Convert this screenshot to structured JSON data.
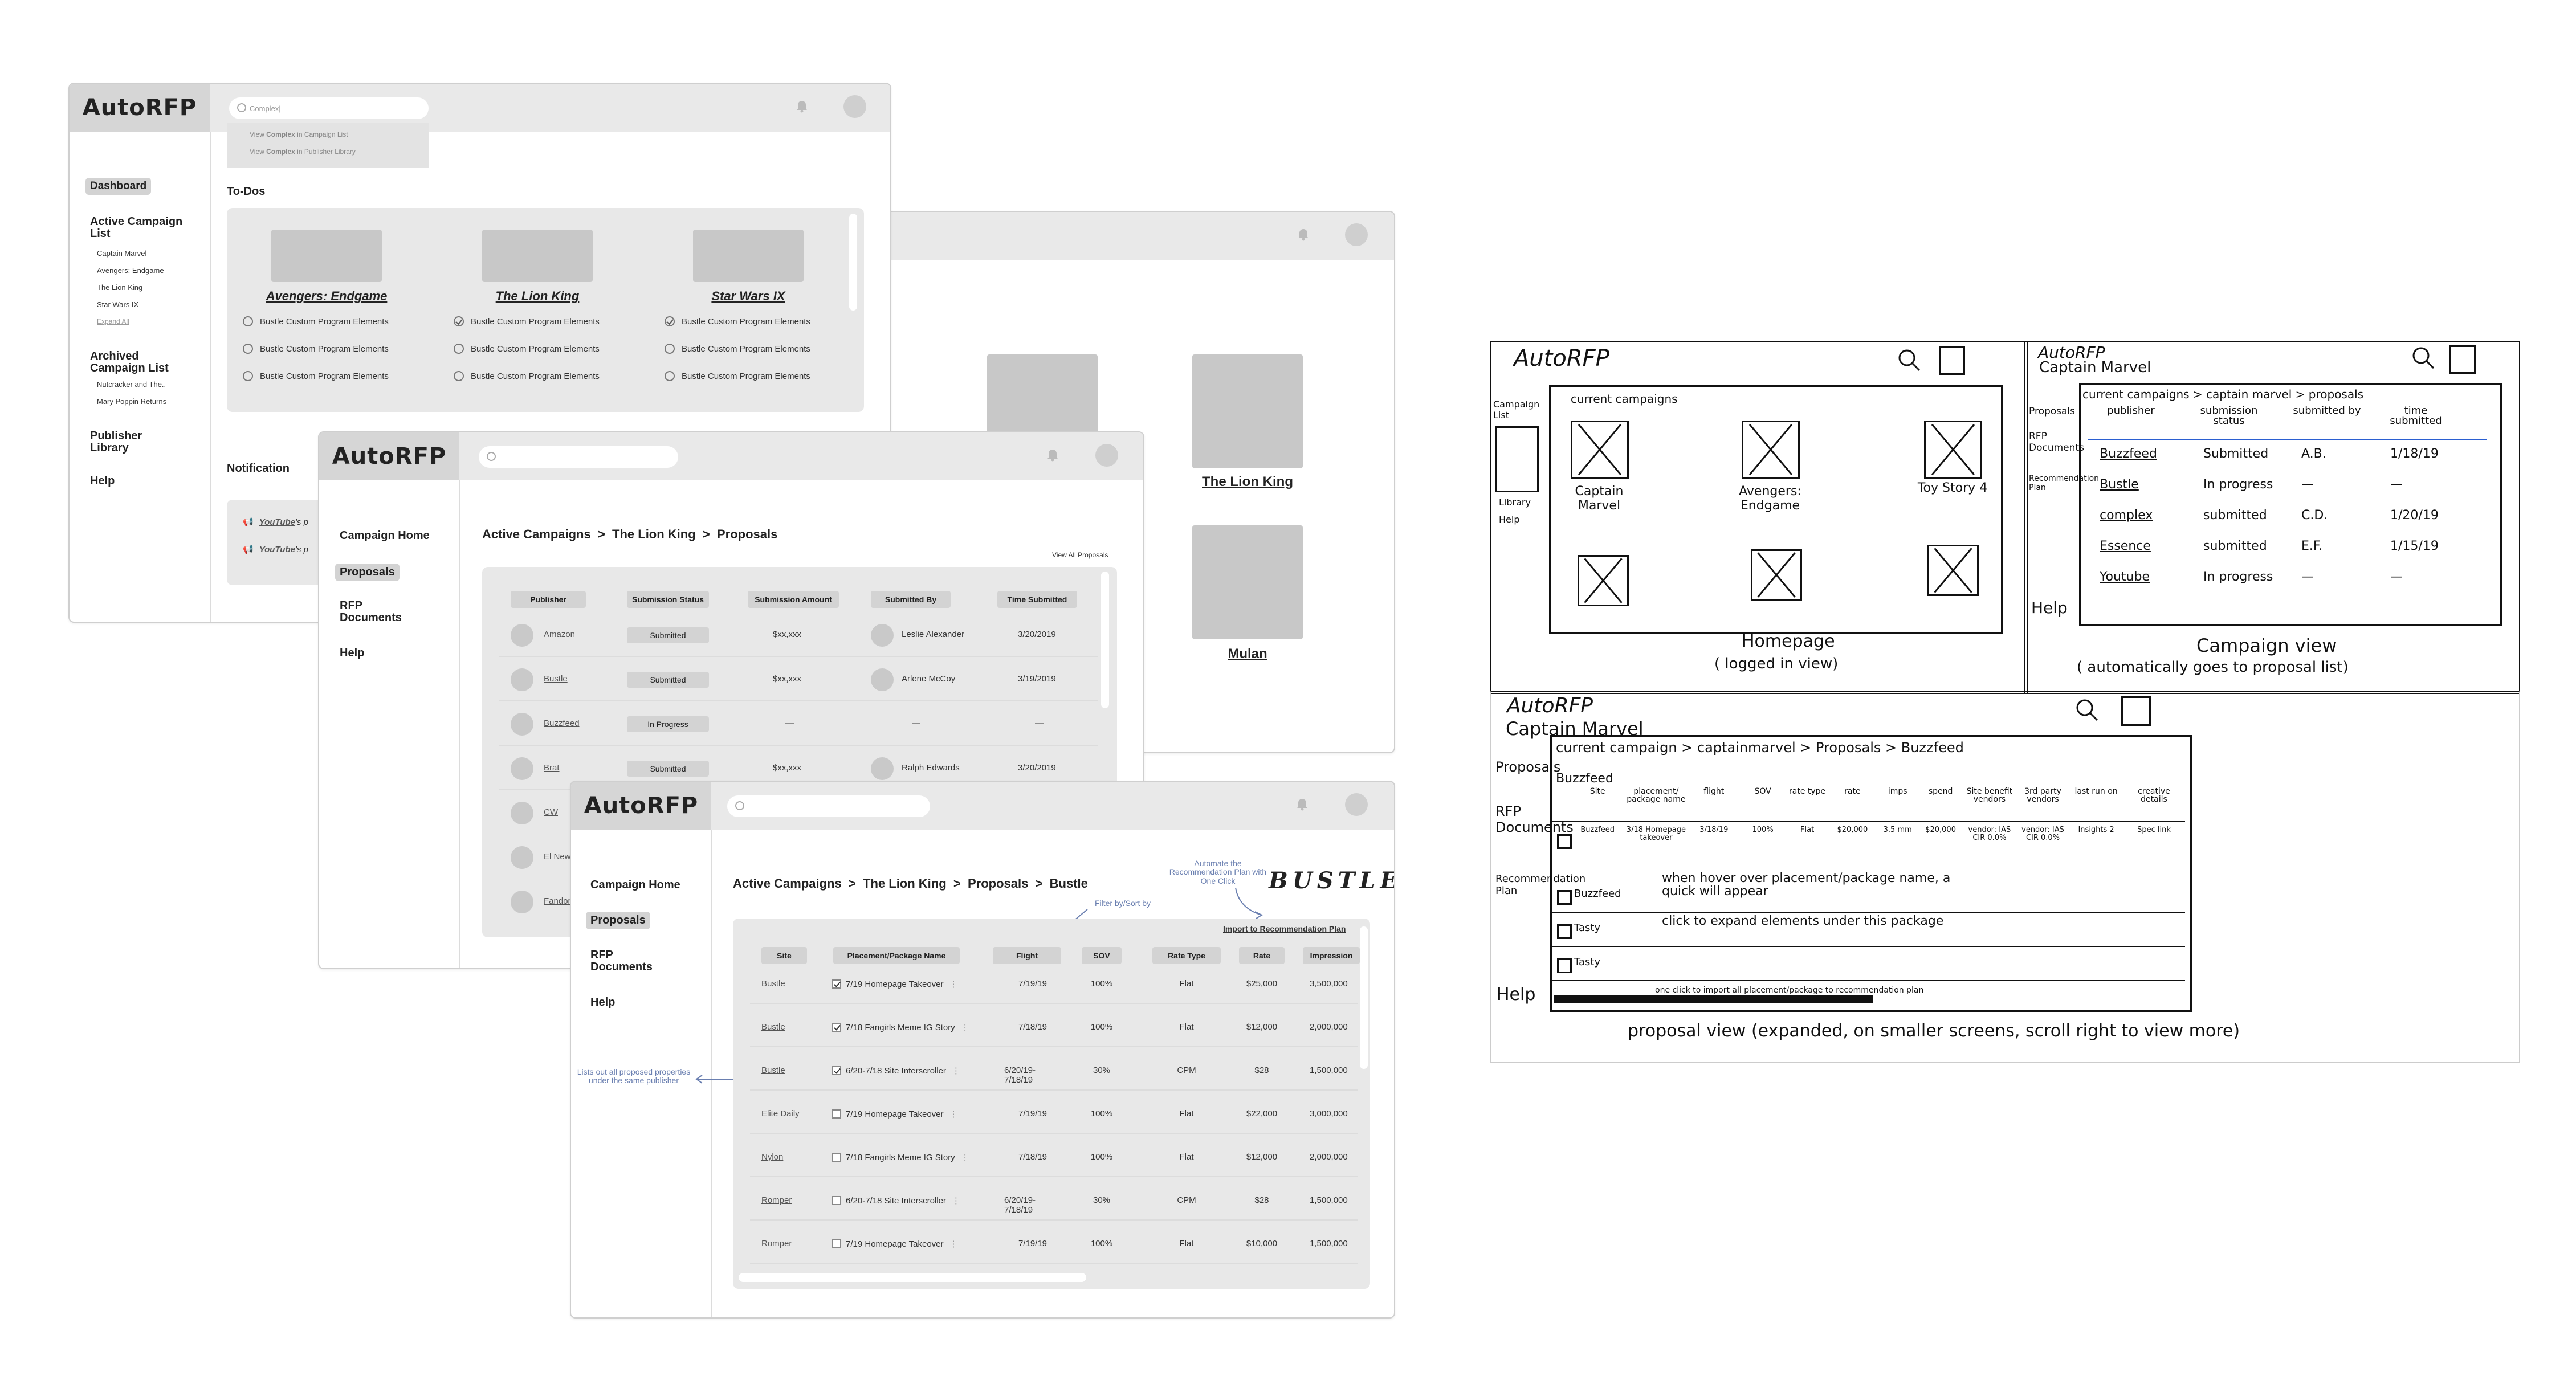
{
  "app": {
    "logo": "AutoRFP"
  },
  "dashboard": {
    "search_value": "Complex|",
    "suggestions": [
      {
        "prefix": "View ",
        "bold": "Complex",
        "suffix": " in Campaign List"
      },
      {
        "prefix": "View ",
        "bold": "Complex",
        "suffix": " in Publisher Library"
      }
    ],
    "nav": {
      "dashboard": "Dashboard",
      "active_title": "Active Campaign List",
      "active_items": [
        "Captain Marvel",
        "Avengers: Endgame",
        "The Lion King",
        "Star Wars IX"
      ],
      "expand": "Expand All",
      "archived_title": "Archived Campaign List",
      "archived_items": [
        "Nutcracker and The..",
        "Mary Poppin Returns"
      ],
      "publisher": "Publisher Library",
      "help": "Help"
    },
    "todos_title": "To-Dos",
    "todos": [
      {
        "movie": "Avengers: Endgame",
        "items": [
          {
            "t": "Bustle Custom Program Elements",
            "done": false
          },
          {
            "t": "Bustle Custom Program Elements",
            "done": false
          },
          {
            "t": "Bustle Custom Program Elements",
            "done": false
          }
        ]
      },
      {
        "movie": "The Lion King",
        "items": [
          {
            "t": "Bustle Custom Program Elements",
            "done": true
          },
          {
            "t": "Bustle Custom Program Elements",
            "done": false
          },
          {
            "t": "Bustle Custom Program Elements",
            "done": false
          }
        ]
      },
      {
        "movie": "Star Wars IX",
        "items": [
          {
            "t": "Bustle Custom Program Elements",
            "done": true
          },
          {
            "t": "Bustle Custom Program Elements",
            "done": false
          },
          {
            "t": "Bustle Custom Program Elements",
            "done": false
          }
        ]
      }
    ],
    "notification_title": "Notification",
    "notifications": [
      {
        "bold": "YouTube",
        "rest": "'s p"
      },
      {
        "bold": "YouTube",
        "rest": "'s p"
      }
    ]
  },
  "back_window": {
    "movies": [
      "The Lion King",
      "Mulan"
    ]
  },
  "proposals": {
    "nav": {
      "home": "Campaign Home",
      "proposals": "Proposals",
      "rfp": "RFP Documents",
      "help": "Help"
    },
    "breadcrumb": "Active Campaigns  >  The Lion King  >  Proposals",
    "view_all": "View All Proposals",
    "columns": [
      "Publisher",
      "Submission Status",
      "Submission Amount",
      "Submitted By",
      "Time Submitted"
    ],
    "rows": [
      {
        "pub": "Amazon",
        "status": "Submitted",
        "amount": "$xx,xxx",
        "by": "Leslie Alexander",
        "time": "3/20/2019",
        "avatar": true
      },
      {
        "pub": "Bustle",
        "status": "Submitted",
        "amount": "$xx,xxx",
        "by": "Arlene McCoy",
        "time": "3/19/2019",
        "avatar": true
      },
      {
        "pub": "Buzzfeed",
        "status": "In Progress",
        "amount": "—",
        "by": "—",
        "time": "—",
        "avatar": false
      },
      {
        "pub": "Brat",
        "status": "Submitted",
        "amount": "$xx,xxx",
        "by": "Ralph Edwards",
        "time": "3/20/2019",
        "avatar": true
      },
      {
        "pub": "CW",
        "status": "",
        "amount": "",
        "by": "",
        "time": "",
        "avatar": false
      },
      {
        "pub": "El New",
        "status": "",
        "amount": "",
        "by": "",
        "time": "",
        "avatar": false
      },
      {
        "pub": "Fandor",
        "status": "",
        "amount": "",
        "by": "",
        "time": "",
        "avatar": false
      }
    ]
  },
  "proposal_detail": {
    "breadcrumb": "Active Campaigns  >  The Lion King  >  Proposals  >  Bustle",
    "brand": "BUSTLE",
    "import": "Import to Recommendation Plan",
    "annot_automate": "Automate the Recommendation Plan with One Click",
    "annot_filter": "Filter by/Sort by",
    "annot_lists": "Lists out all proposed properties under the same publisher",
    "columns": [
      "Site",
      "Placement/Package Name",
      "Flight",
      "SOV",
      "Rate Type",
      "Rate",
      "Impression"
    ],
    "rows": [
      {
        "site": "Bustle",
        "checked": true,
        "name": "7/19 Homepage Takeover",
        "flight": "7/19/19",
        "sov": "100%",
        "type": "Flat",
        "rate": "$25,000",
        "imp": "3,500,000"
      },
      {
        "site": "Bustle",
        "checked": true,
        "name": "7/18 Fangirls Meme IG Story",
        "flight": "7/18/19",
        "sov": "100%",
        "type": "Flat",
        "rate": "$12,000",
        "imp": "2,000,000"
      },
      {
        "site": "Bustle",
        "checked": true,
        "name": "6/20-7/18 Site Interscroller",
        "flight": "6/20/19-7/18/19",
        "sov": "30%",
        "type": "CPM",
        "rate": "$28",
        "imp": "1,500,000"
      },
      {
        "site": "Elite Daily",
        "checked": false,
        "name": "7/19 Homepage Takeover",
        "flight": "7/19/19",
        "sov": "100%",
        "type": "Flat",
        "rate": "$22,000",
        "imp": "3,000,000"
      },
      {
        "site": "Nylon",
        "checked": false,
        "name": "7/18 Fangirls Meme IG Story",
        "flight": "7/18/19",
        "sov": "100%",
        "type": "Flat",
        "rate": "$12,000",
        "imp": "2,000,000"
      },
      {
        "site": "Romper",
        "checked": false,
        "name": "6/20-7/18 Site Interscroller",
        "flight": "6/20/19-7/18/19",
        "sov": "30%",
        "type": "CPM",
        "rate": "$28",
        "imp": "1,500,000"
      },
      {
        "site": "Romper",
        "checked": false,
        "name": "7/19 Homepage Takeover",
        "flight": "7/19/19",
        "sov": "100%",
        "type": "Flat",
        "rate": "$10,000",
        "imp": "1,500,000"
      }
    ]
  },
  "sketches": {
    "home": {
      "logo": "AutoRFP",
      "nav": [
        "Campaign List",
        "Library",
        "Help"
      ],
      "section": "current campaigns",
      "tiles": [
        "Captain Marvel",
        "Avengers: Endgame",
        "Toy Story 4"
      ],
      "caption1": "Homepage",
      "caption2": "( logged in view)"
    },
    "campaign": {
      "logo": "AutoRFP",
      "subtitle": "Captain Marvel",
      "crumb": "current campaigns > captain marvel > proposals",
      "nav": [
        "Proposals",
        "RFP Documents",
        "Recommendation Plan",
        "Help"
      ],
      "columns": [
        "publisher",
        "submission status",
        "submitted by",
        "time submitted"
      ],
      "rows": [
        [
          "Buzzfeed",
          "Submitted",
          "A.B.",
          "1/18/19"
        ],
        [
          "Bustle",
          "In progress",
          "—",
          "—"
        ],
        [
          "complex",
          "submitted",
          "C.D.",
          "1/20/19"
        ],
        [
          "Essence",
          "submitted",
          "E.F.",
          "1/15/19"
        ],
        [
          "Youtube",
          "In progress",
          "—",
          "—"
        ]
      ],
      "caption1": "Campaign view",
      "caption2": "( automatically goes to proposal list)"
    },
    "proposal": {
      "logo": "AutoRFP",
      "subtitle": "Captain Marvel",
      "crumb": "current campaign > captainmarvel > Proposals > Buzzfeed",
      "nav": [
        "Proposals",
        "RFP Documents",
        "Recommendation Plan",
        "Help"
      ],
      "publisher": "Buzzfeed",
      "columns": [
        "Site",
        "placement/ package name",
        "flight",
        "SOV",
        "rate type",
        "rate",
        "imps",
        "spend",
        "Site benefit vendors",
        "3rd party vendors",
        "last run on",
        "creative details"
      ],
      "first_row": [
        "Buzzfeed",
        "3/18 Homepage takeover",
        "3/18/19",
        "100%",
        "Flat",
        "$20,000",
        "3.5 mm",
        "$20,000",
        "vendor: IAS CIR 0.0%",
        "vendor: IAS CIR 0.0%",
        "Insights 2",
        "Spec link"
      ],
      "rows": [
        "Buzzfeed",
        "Tasty",
        "Tasty"
      ],
      "note1": "when hover over placement/package name, a quick will appear",
      "note2": "click to expand elements under this package",
      "note3": "one click to import all placement/package to recommendation plan",
      "caption": "proposal view (expanded, on smaller screens, scroll right to view more)"
    }
  }
}
